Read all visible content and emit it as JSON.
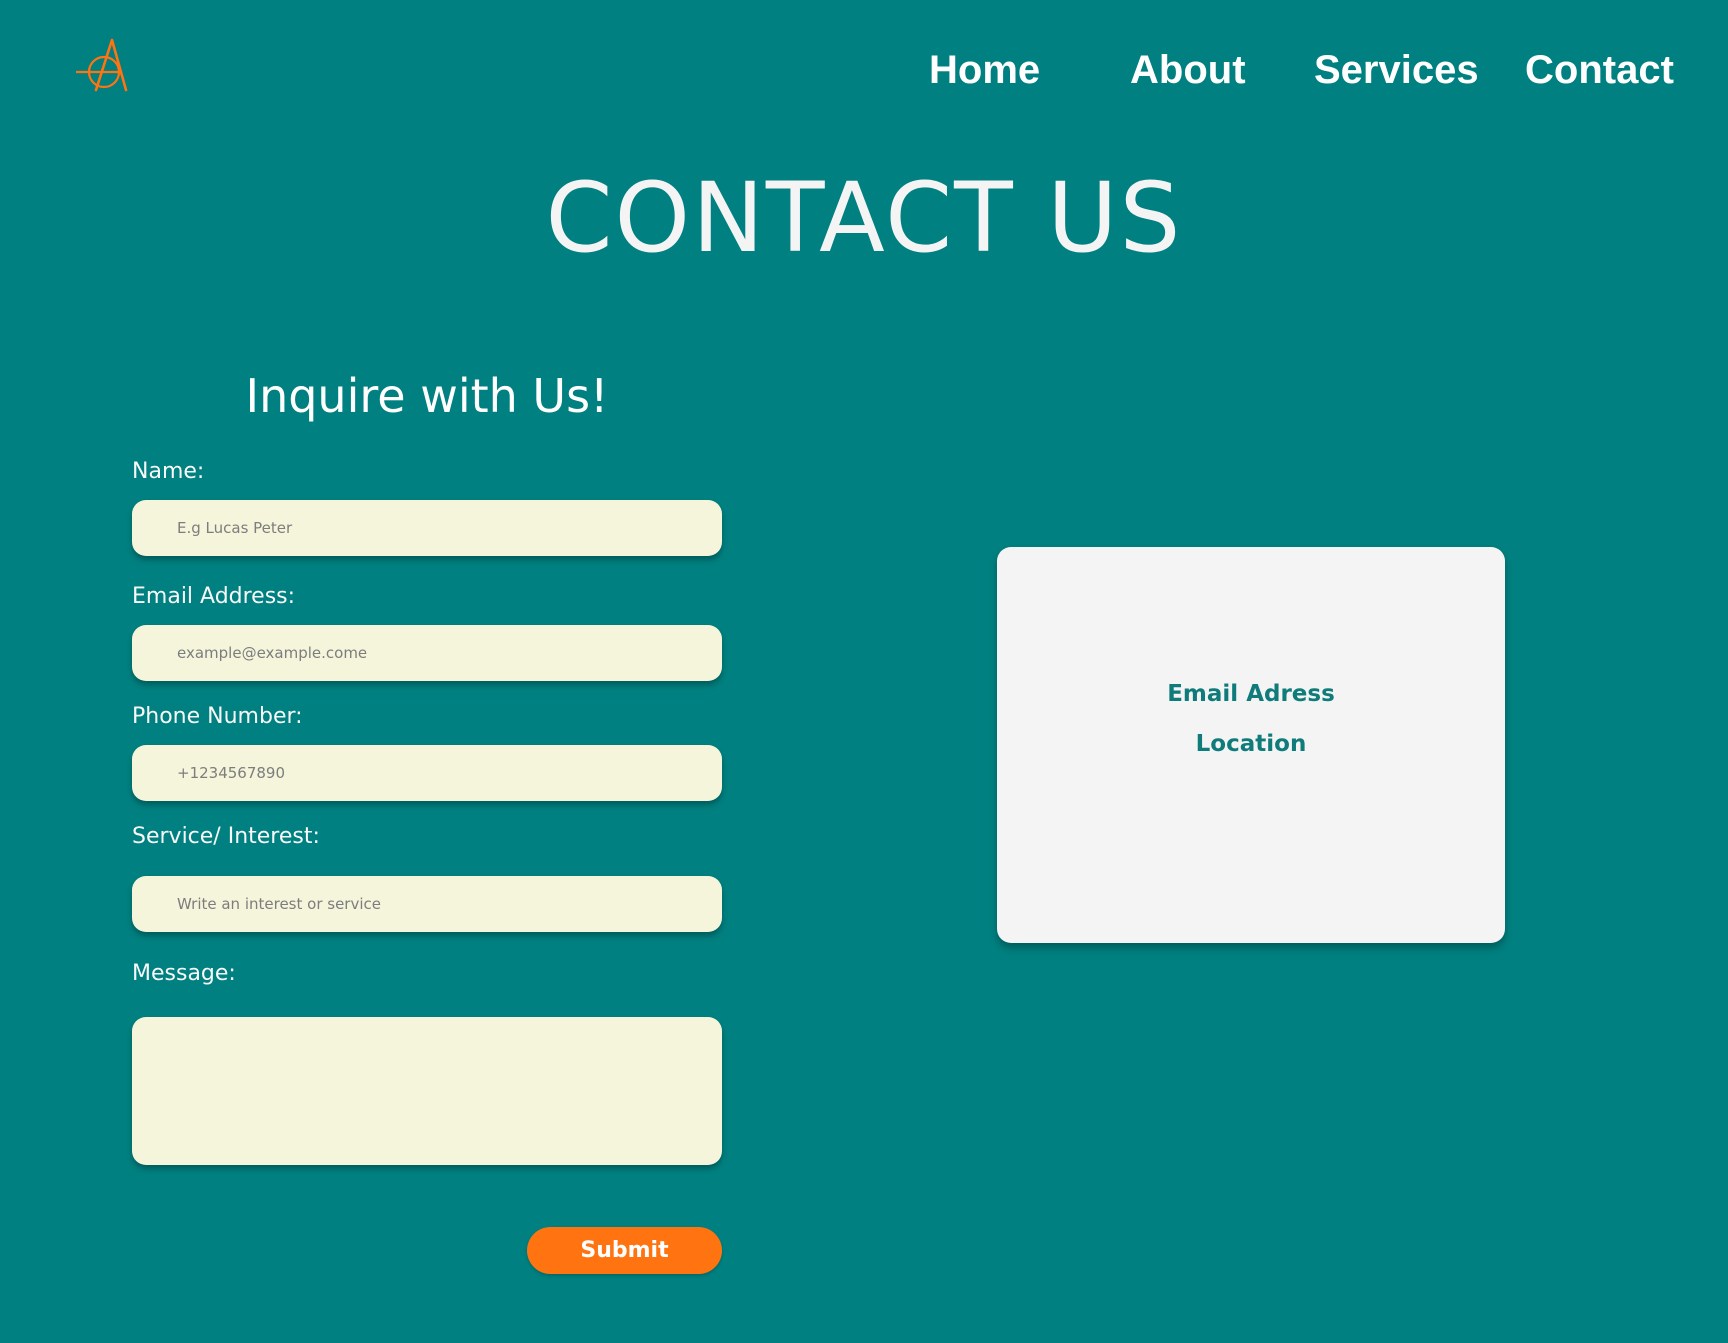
{
  "brand": {
    "logo_icon": "stylized-A-logo-icon",
    "accent_color": "#ff7410"
  },
  "colors": {
    "background": "#008080",
    "field_background": "#f5f5dc",
    "card_background": "#f4f4f4",
    "card_text": "#0f7b7b"
  },
  "nav": {
    "items": [
      {
        "label": "Home"
      },
      {
        "label": "About"
      },
      {
        "label": "Services"
      },
      {
        "label": "Contact"
      }
    ]
  },
  "page": {
    "title": "CONTACT US"
  },
  "form": {
    "heading": "Inquire with Us!",
    "name": {
      "label": "Name:",
      "placeholder": "E.g Lucas Peter",
      "value": ""
    },
    "email": {
      "label": "Email Address:",
      "placeholder": "example@example.come",
      "value": ""
    },
    "phone": {
      "label": "Phone Number:",
      "placeholder": "+1234567890",
      "value": ""
    },
    "service": {
      "label": "Service/ Interest:",
      "placeholder": "Write an interest or service",
      "value": ""
    },
    "message": {
      "label": "Message:",
      "placeholder": "",
      "value": ""
    },
    "submit_label": "Submit"
  },
  "info_card": {
    "email_label": "Email Adress",
    "location_label": "Location"
  }
}
